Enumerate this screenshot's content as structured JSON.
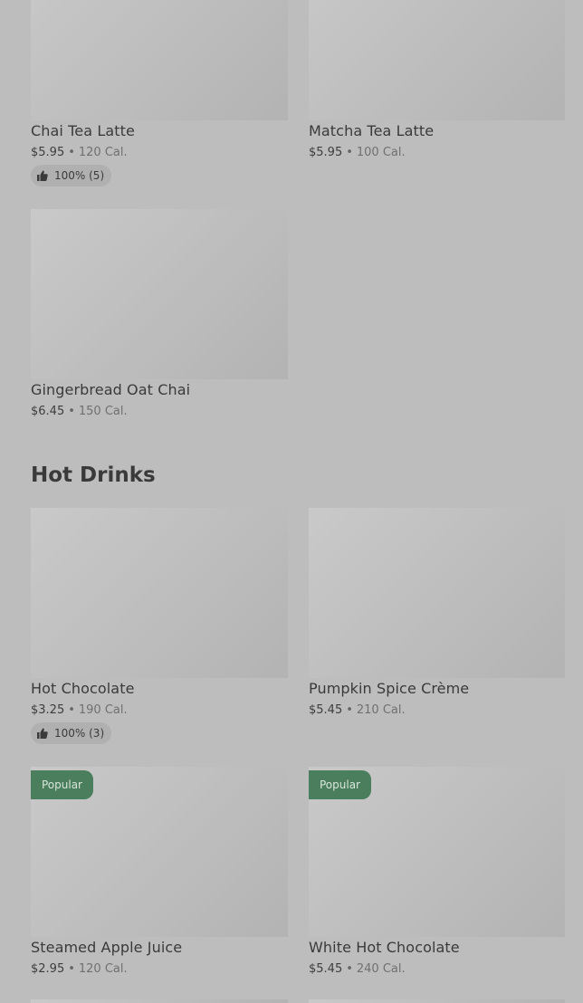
{
  "top_items": [
    {
      "name": "Chai Tea Latte",
      "price": "$5.95",
      "separator": "•",
      "calories": "120 Cal.",
      "rating": "100% (5)"
    },
    {
      "name": "Matcha Tea Latte",
      "price": "$5.95",
      "separator": "•",
      "calories": "100 Cal."
    },
    {
      "name": "Gingerbread Oat Chai",
      "price": "$6.45",
      "separator": "•",
      "calories": "150 Cal."
    }
  ],
  "hot_drinks": {
    "heading": "Hot Drinks",
    "items": [
      {
        "name": "Hot Chocolate",
        "price": "$3.25",
        "separator": "•",
        "calories": "190 Cal.",
        "rating": "100% (3)"
      },
      {
        "name": "Pumpkin Spice Crème",
        "price": "$5.45",
        "separator": "•",
        "calories": "210 Cal."
      },
      {
        "name": "Steamed Apple Juice",
        "price": "$2.95",
        "separator": "•",
        "calories": "120 Cal.",
        "badge": "Popular"
      },
      {
        "name": "White Hot Chocolate",
        "price": "$5.45",
        "separator": "•",
        "calories": "240 Cal.",
        "badge": "Popular"
      }
    ]
  },
  "colors": {
    "background": "#bdbdbd",
    "popular_badge": "#4a7e5c",
    "rating_pill": "#b0b0b0"
  },
  "icons": {
    "rating": "thumbs-up-icon"
  }
}
